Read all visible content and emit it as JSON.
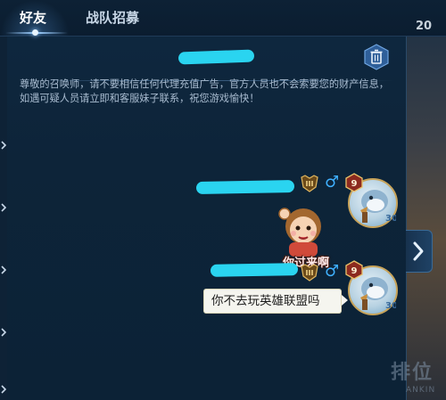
{
  "tabs": [
    {
      "label": "好友",
      "active": true
    },
    {
      "label": "战队招募",
      "active": false
    }
  ],
  "background": {
    "counter": "20",
    "bottom_text": "排位",
    "bottom_small": "ANKIN"
  },
  "notice": "尊敬的召唤师，请不要相信任何代理充值广告，官方人员也不会索要您的财产信息，如遇可疑人员请立即和客服妹子联系，祝您游戏愉快！",
  "messages": [
    {
      "type": "sticker",
      "sticker_text": "你过来啊",
      "rank": "III",
      "gender": "♂",
      "level": "9"
    },
    {
      "type": "text",
      "text": "你不去玩英雄联盟吗",
      "rank": "III",
      "gender": "♂",
      "level": "9"
    }
  ],
  "icons": {
    "trash": "trash-icon",
    "collapse": "chevron-right-icon",
    "gender": "male-icon"
  },
  "colors": {
    "accent": "#2ad4f0",
    "panel": "#0d2439",
    "bubble": "#f5f5ef",
    "gender": "#3fb0ff",
    "rank_gold": "#c8a45a"
  }
}
